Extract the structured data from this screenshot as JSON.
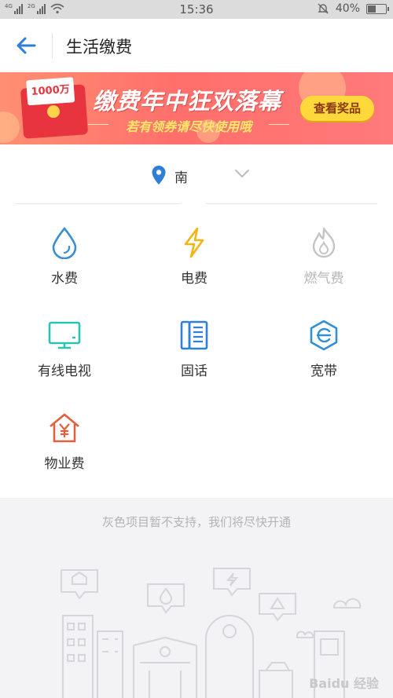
{
  "status_bar": {
    "network_1": "4G",
    "network_2": "2G",
    "time": "15:36",
    "battery": "40%",
    "battery_level": 0.4
  },
  "header": {
    "back_icon": "arrow-left-icon",
    "title": "生活缴费"
  },
  "banner": {
    "envelope_amount": "1000万",
    "headline": "缴费年中狂欢落幕",
    "subline": "若有领券请尽快使用哦",
    "button": "查看奖品"
  },
  "location": {
    "icon": "map-pin-icon",
    "city": "南",
    "dropdown_icon": "chevron-down-icon"
  },
  "services": [
    {
      "label": "水费",
      "icon": "water-drop-icon",
      "enabled": true
    },
    {
      "label": "电费",
      "icon": "lightning-icon",
      "enabled": true
    },
    {
      "label": "燃气费",
      "icon": "flame-icon",
      "enabled": false
    },
    {
      "label": "有线电视",
      "icon": "tv-icon",
      "enabled": true
    },
    {
      "label": "固话",
      "icon": "telephone-icon",
      "enabled": true
    },
    {
      "label": "宽带",
      "icon": "broadband-icon",
      "enabled": true
    },
    {
      "label": "物业费",
      "icon": "house-yen-icon",
      "enabled": true
    }
  ],
  "notice": "灰色项目暂不支持，我们将尽快开通",
  "watermark": "Baidu 经验",
  "colors": {
    "accent_blue": "#2f7fd8",
    "water": "#3a8fd0",
    "electric": "#f1b514",
    "gas_disabled": "#c4c4c4",
    "tv": "#2ec2b4",
    "phone": "#2f7fd8",
    "broadband": "#2f8fd8",
    "property": "#e2603f",
    "banner_red": "#ff6f6b",
    "button_yellow": "#ffd93b"
  }
}
